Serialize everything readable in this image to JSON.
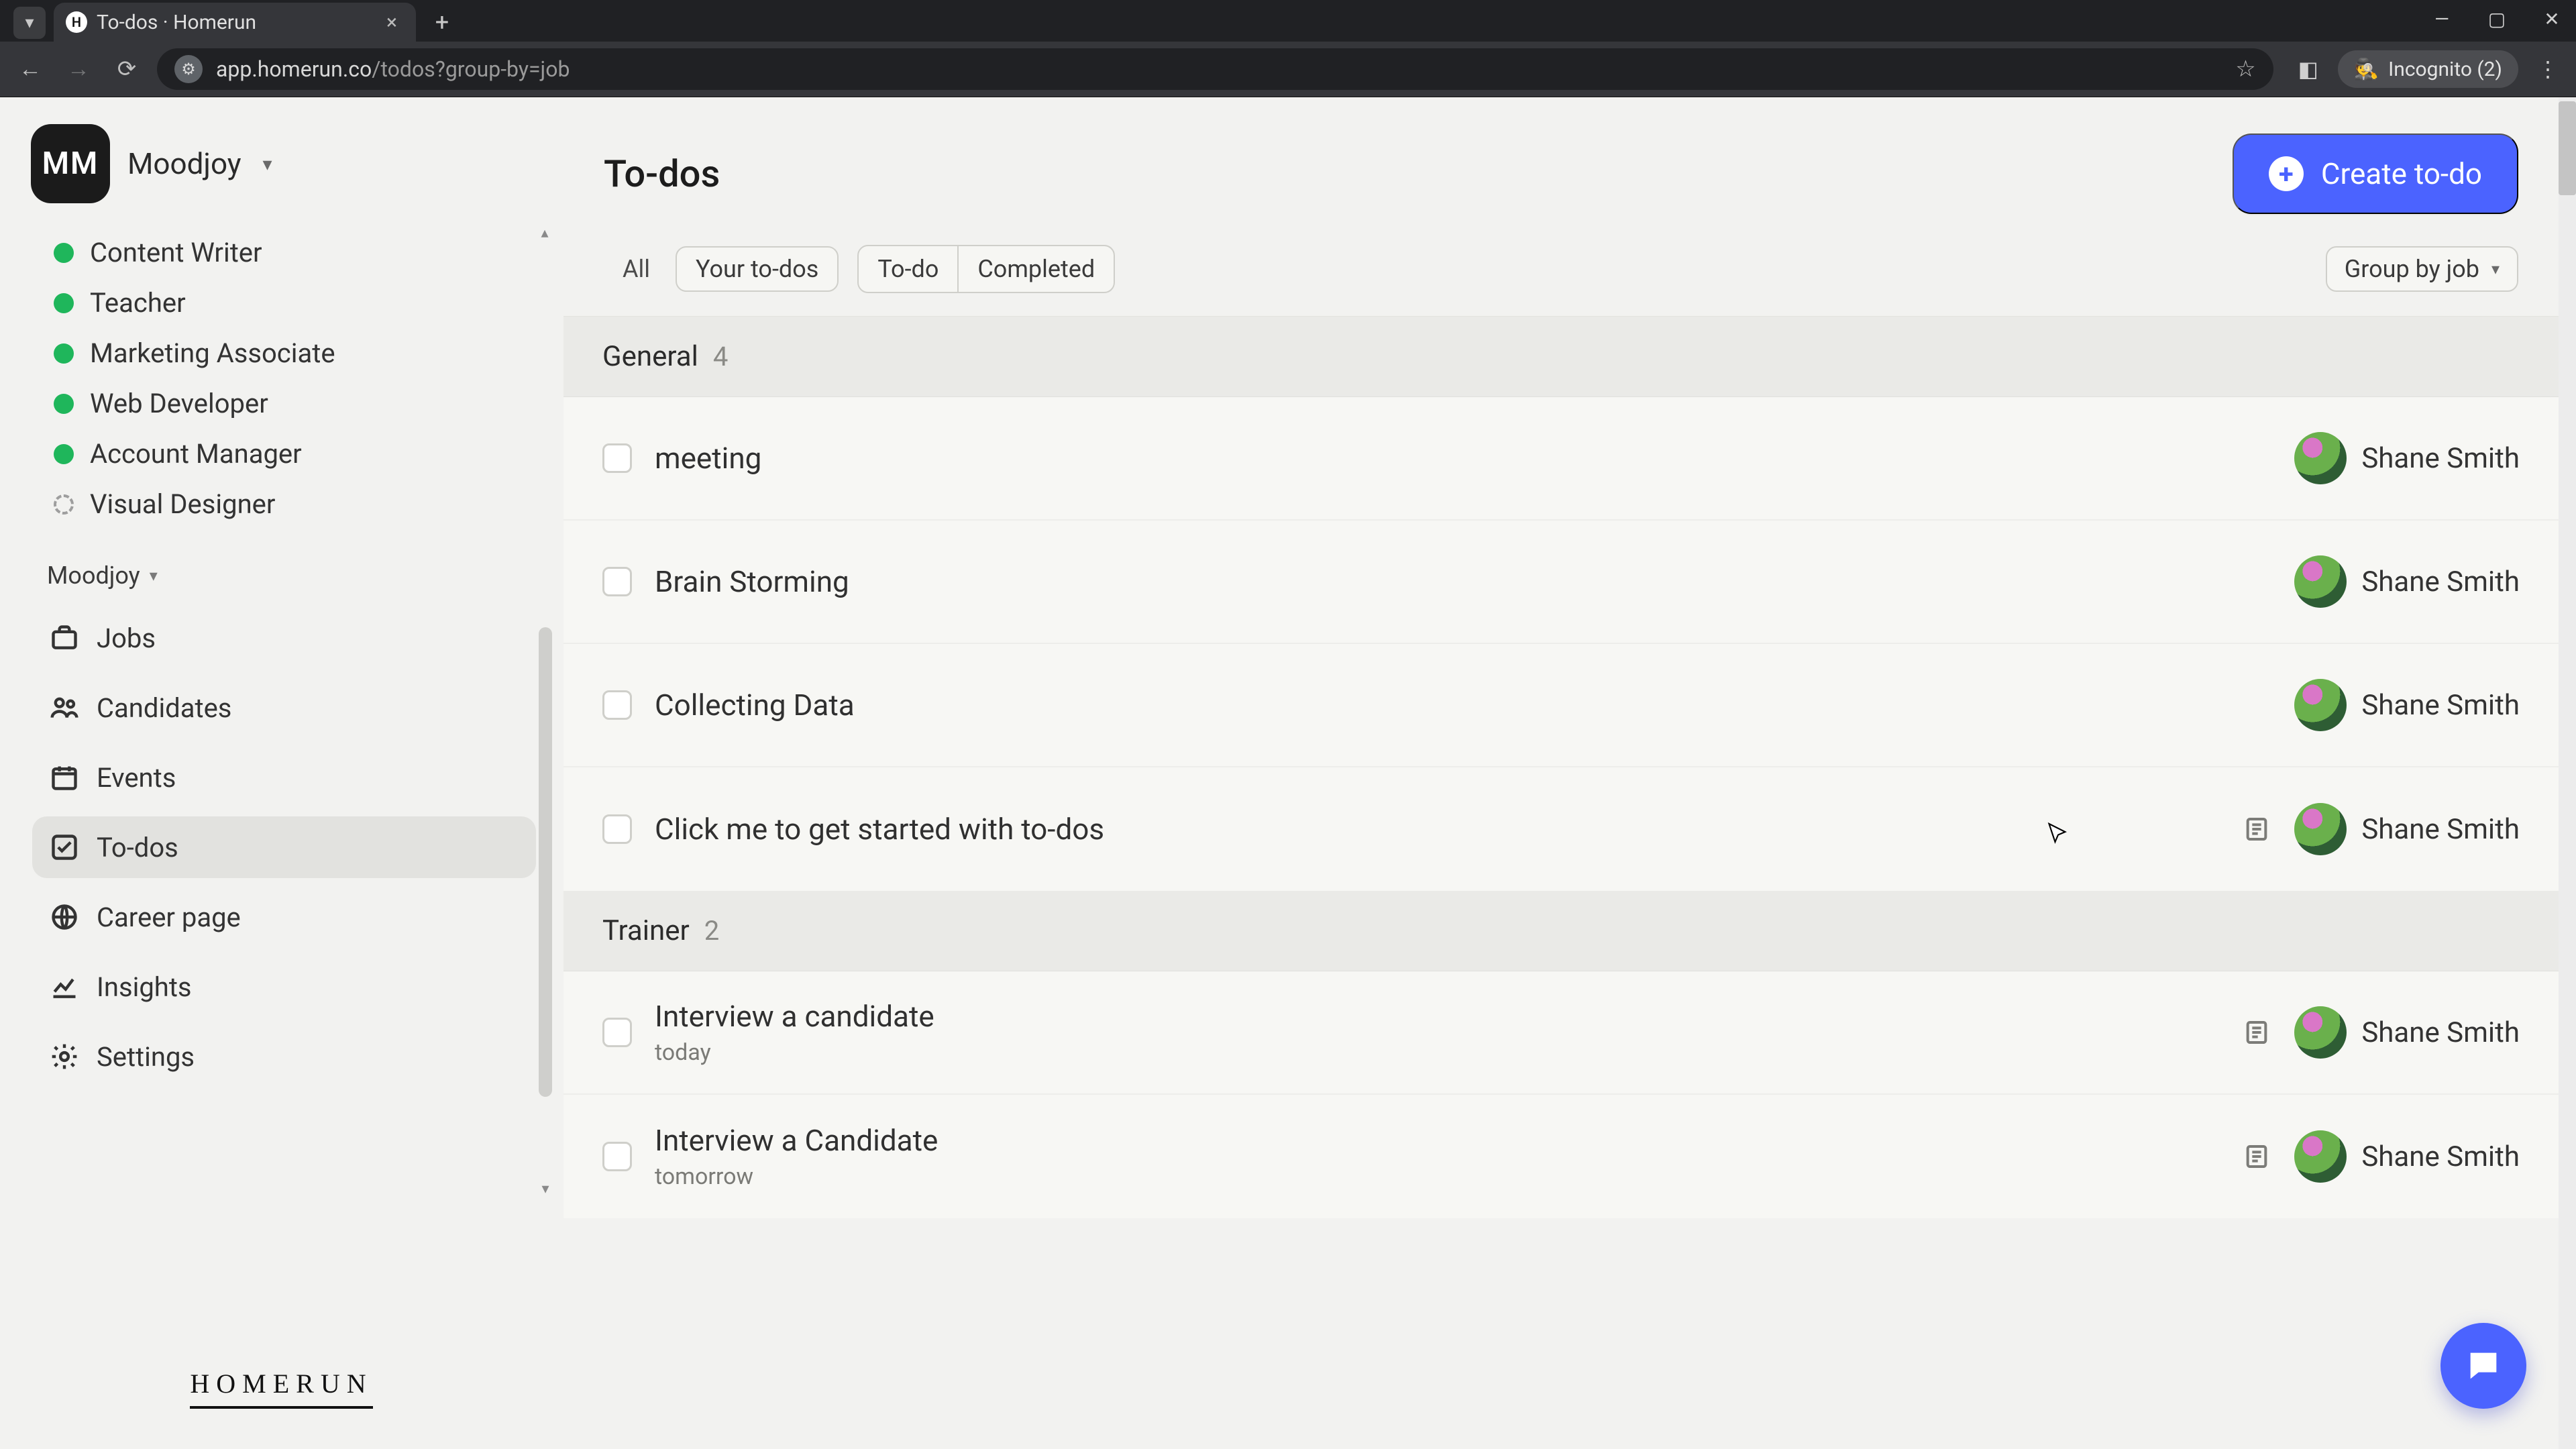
{
  "browser": {
    "tab_title": "To-dos · Homerun",
    "url_host": "app.homerun.co",
    "url_path": "/todos?group-by=job",
    "incognito_label": "Incognito (2)"
  },
  "org": {
    "avatar_initials": "MM",
    "name": "Moodjoy"
  },
  "jobs": [
    {
      "label": "Content Writer",
      "status": "green"
    },
    {
      "label": "Teacher",
      "status": "green"
    },
    {
      "label": "Marketing Associate",
      "status": "green"
    },
    {
      "label": "Web Developer",
      "status": "green"
    },
    {
      "label": "Account Manager",
      "status": "green"
    },
    {
      "label": "Visual Designer",
      "status": "dashed"
    }
  ],
  "sidebar_section_label": "Moodjoy",
  "nav": {
    "jobs": "Jobs",
    "candidates": "Candidates",
    "events": "Events",
    "todos": "To-dos",
    "career_page": "Career page",
    "insights": "Insights",
    "settings": "Settings"
  },
  "brand_footer": "HOMERUN",
  "header": {
    "page_title": "To-dos",
    "create_button": "Create to-do"
  },
  "filters": {
    "all": "All",
    "your_todos": "Your to-dos",
    "todo": "To-do",
    "completed": "Completed",
    "group_by": "Group by job"
  },
  "sections": [
    {
      "title": "General",
      "count": "4",
      "items": [
        {
          "title": "meeting",
          "assignee": "Shane Smith",
          "has_note": false
        },
        {
          "title": "Brain Storming",
          "assignee": "Shane Smith",
          "has_note": false
        },
        {
          "title": "Collecting Data",
          "assignee": "Shane Smith",
          "has_note": false
        },
        {
          "title": "Click me to get started with to-dos",
          "assignee": "Shane Smith",
          "has_note": true
        }
      ]
    },
    {
      "title": "Trainer",
      "count": "2",
      "items": [
        {
          "title": "Interview a candidate",
          "sub": "today",
          "assignee": "Shane Smith",
          "has_note": true
        },
        {
          "title": "Interview a Candidate",
          "sub": "tomorrow",
          "assignee": "Shane Smith",
          "has_note": true
        }
      ]
    }
  ]
}
